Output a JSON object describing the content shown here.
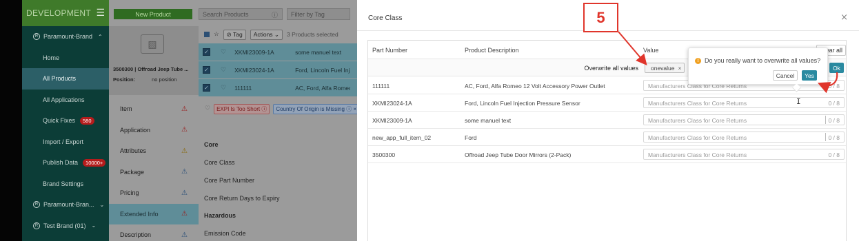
{
  "sidebar": {
    "title": "DEVELOPMENT",
    "brands": [
      "Paramount-Brand",
      "Paramount-Bran...",
      "Test Brand (01)"
    ],
    "items": [
      {
        "label": "Home"
      },
      {
        "label": "All Products"
      },
      {
        "label": "All Applications"
      },
      {
        "label": "Quick Fixes",
        "badge": "580"
      },
      {
        "label": "Import / Export"
      },
      {
        "label": "Publish Data",
        "badge": "10000+"
      },
      {
        "label": "Brand Settings"
      }
    ]
  },
  "mid": {
    "new_product": "New Product",
    "product_title": "3500300 | Offroad Jeep Tube ...",
    "position_label": "Position:",
    "position_value": "no position",
    "tabs": [
      "Item",
      "Application",
      "Attributes",
      "Package",
      "Pricing",
      "Extended Info",
      "Description"
    ],
    "tab_warnings": [
      "red",
      "red",
      "yellow",
      "blue",
      "blue",
      "red",
      "blue"
    ]
  },
  "list": {
    "search_placeholder": "Search Products",
    "filter_placeholder": "Filter by Tag",
    "toolbar": {
      "tag": "Tag",
      "actions": "Actions",
      "selected": "3 Products selected"
    },
    "rows": [
      {
        "part": "XKMI23009-1A",
        "desc": "some manuel text"
      },
      {
        "part": "XKMI23024-1A",
        "desc": "Ford, Lincoln Fuel Inj"
      },
      {
        "part": "111111",
        "desc": "AC, Ford, Alfa Romeo"
      }
    ],
    "warnings": [
      "EXPI Is Too Short",
      "Country Of Origin is Missing"
    ],
    "fields": [
      "Core",
      "Core Class",
      "Core Part Number",
      "Core Return Days to Expiry",
      "Hazardous",
      "Emission Code"
    ]
  },
  "modal": {
    "title": "Core Class",
    "headers": {
      "part_number": "Part Number",
      "description": "Product Description",
      "value": "Value",
      "clear_all": "Clear all"
    },
    "overwrite_label": "Overwrite all values",
    "overwrite_value": "onevalue",
    "ok_label": "Ok",
    "input_placeholder": "Manufacturers Class for Core Returns",
    "rows": [
      {
        "part": "111111",
        "desc": "AC, Ford, Alfa Romeo 12 Volt Accessory Power Outlet",
        "count": "0 / 8"
      },
      {
        "part": "XKMI23024-1A",
        "desc": "Ford, Lincoln Fuel Injection Pressure Sensor",
        "count": "0 / 8"
      },
      {
        "part": "XKMI23009-1A",
        "desc": "some manuel text",
        "count": "0 / 8"
      },
      {
        "part": "new_app_full_item_02",
        "desc": "Ford",
        "count": "0 / 8"
      },
      {
        "part": "3500300",
        "desc": "Offroad Jeep Tube Door Mirrors (2-Pack)",
        "count": "0 / 8"
      }
    ]
  },
  "popconfirm": {
    "message": "Do you really want to overwrite all values?",
    "cancel": "Cancel",
    "yes": "Yes"
  },
  "annotation": {
    "step": "5",
    "color": "#e0352b"
  }
}
